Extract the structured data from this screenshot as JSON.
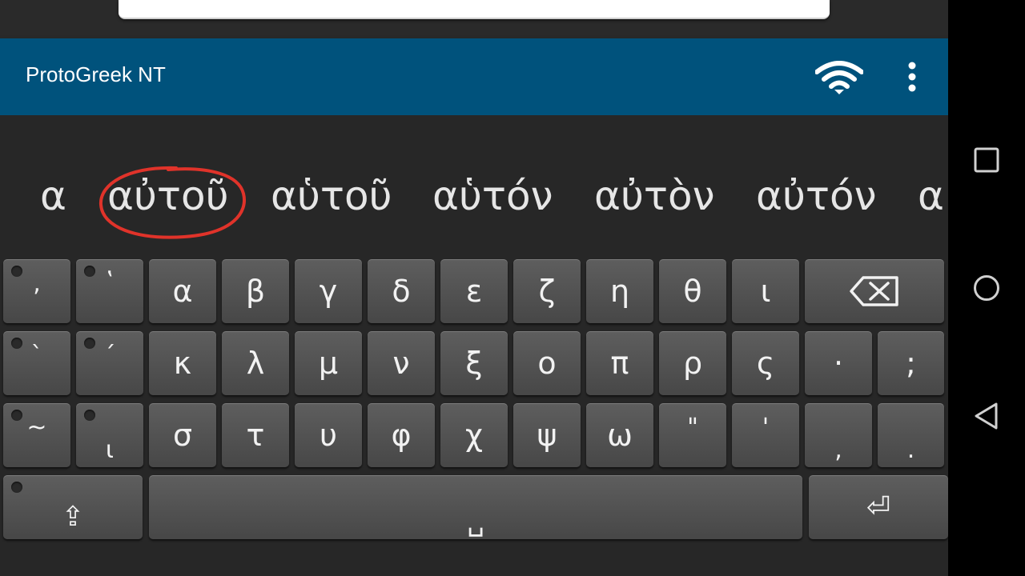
{
  "app_bar": {
    "title": "ProtoGreek NT",
    "bg_color": "#00527c"
  },
  "suggestions": [
    "α",
    "αὐτοῦ",
    "αὑτοῦ",
    "αὑτόν",
    "αὐτὸν",
    "αὐτόν",
    "α"
  ],
  "keyboard": {
    "row1": [
      ",",
      "ʽ",
      "α",
      "β",
      "γ",
      "δ",
      "ε",
      "ζ",
      "η",
      "θ",
      "ι"
    ],
    "backspace": "⌫",
    "row2": [
      "`",
      "´",
      "κ",
      "λ",
      "μ",
      "ν",
      "ξ",
      "ο",
      "π",
      "ρ",
      "ς",
      "·",
      ";"
    ],
    "row3": [
      "~",
      "ι",
      "σ",
      "τ",
      "υ",
      "φ",
      "χ",
      "ψ",
      "ω",
      "\"",
      "'",
      ",",
      "."
    ],
    "shift": "⇪",
    "space": "␣",
    "enter": "⏎"
  },
  "nav": {
    "recent": "recent-apps-icon",
    "home": "home-icon",
    "back": "back-icon"
  }
}
